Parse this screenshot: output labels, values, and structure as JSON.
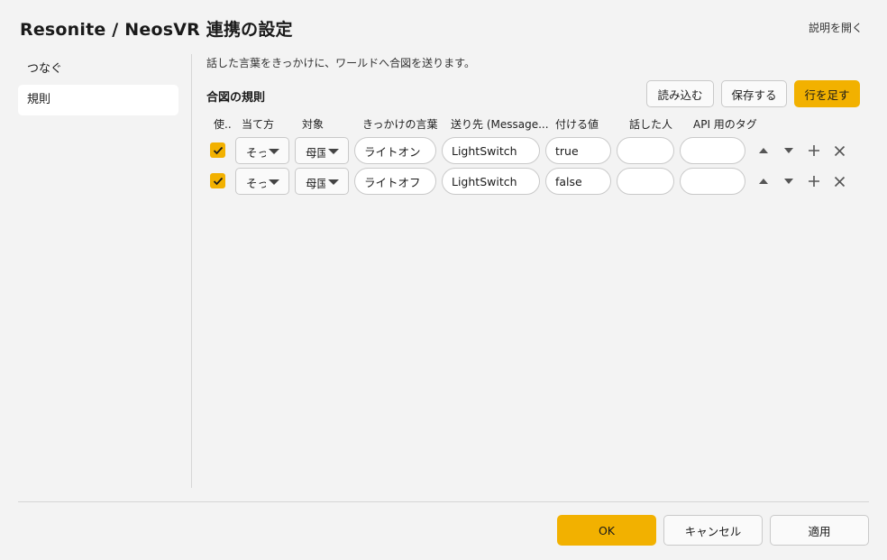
{
  "window": {
    "title": "Resonite / NeosVR 連携の設定",
    "help_link": "説明を開く"
  },
  "sidebar": {
    "items": [
      {
        "label": "つなぐ"
      },
      {
        "label": "規則"
      }
    ]
  },
  "main": {
    "description": "話した言葉をきっかけに、ワールドへ合図を送ります。",
    "section_title": "合図の規則",
    "buttons": {
      "load": "読み込む",
      "save": "保存する",
      "add_row": "行を足す"
    },
    "columns": [
      "使..",
      "当て方",
      "対象",
      "きっかけの言葉",
      "送り先 (Message...",
      "付ける値",
      "話した人",
      "API 用のタグ"
    ],
    "rules": [
      {
        "enabled": true,
        "match": "そっ",
        "target": "母国",
        "trigger": "ライトオン",
        "destination": "LightSwitch",
        "value": "true",
        "speaker": "",
        "api_tag": ""
      },
      {
        "enabled": true,
        "match": "そっ",
        "target": "母国",
        "trigger": "ライトオフ",
        "destination": "LightSwitch",
        "value": "false",
        "speaker": "",
        "api_tag": ""
      }
    ]
  },
  "footer": {
    "ok": "OK",
    "cancel": "キャンセル",
    "apply": "適用"
  },
  "colors": {
    "accent": "#f2b100",
    "background": "#f3f3f3"
  }
}
